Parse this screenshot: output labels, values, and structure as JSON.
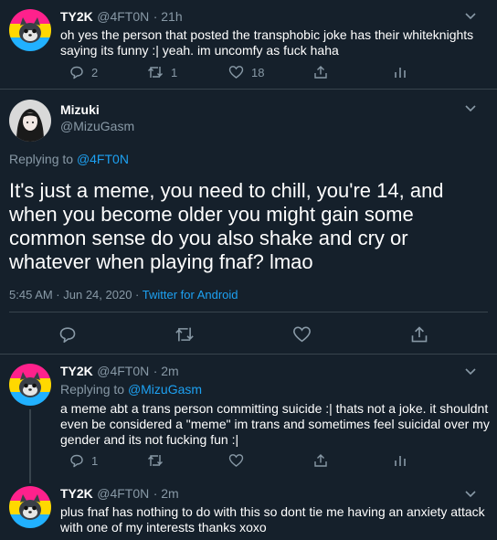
{
  "colors": {
    "background": "#15202b",
    "text": "#ffffff",
    "secondary": "#8899a6",
    "accent": "#1da1f2",
    "divider": "#38444d",
    "avatar_pink": "#ff218c",
    "avatar_yellow": "#ffd800",
    "avatar_blue": "#21b1ff"
  },
  "tweets": [
    {
      "name": "TY2K",
      "handle": "@4FT0N",
      "time": "· 21h",
      "text": "oh yes the person that posted the transphobic joke has their whiteknights saying its funny :| yeah. im uncomfy as fuck haha",
      "reply_count": "2",
      "retweet_count": "1",
      "like_count": "18"
    },
    {
      "name": "Mizuki",
      "handle": "@MizuGasm",
      "replying_prefix": "Replying to",
      "replying_to": "@4FT0N",
      "text": "It's just a meme, you need to chill, you're 14, and when you become older you might gain some common sense do you also shake and cry or whatever when playing fnaf? lmao",
      "timestamp": "5:45 AM · Jun 24, 2020 ·",
      "source": "Twitter for Android"
    },
    {
      "name": "TY2K",
      "handle": "@4FT0N",
      "time": "· 2m",
      "replying_prefix": "Replying to",
      "replying_to": "@MizuGasm",
      "text": "a meme abt a trans person committing suicide :| thats not a joke. it shouldnt even be considered a \"meme\" im trans and sometimes feel suicidal over my gender and its not fucking fun :|",
      "reply_count": "1"
    },
    {
      "name": "TY2K",
      "handle": "@4FT0N",
      "time": "· 2m",
      "text": "plus fnaf has nothing to do with this so dont tie me having an anxiety attack with one of my interests thanks xoxo"
    }
  ]
}
